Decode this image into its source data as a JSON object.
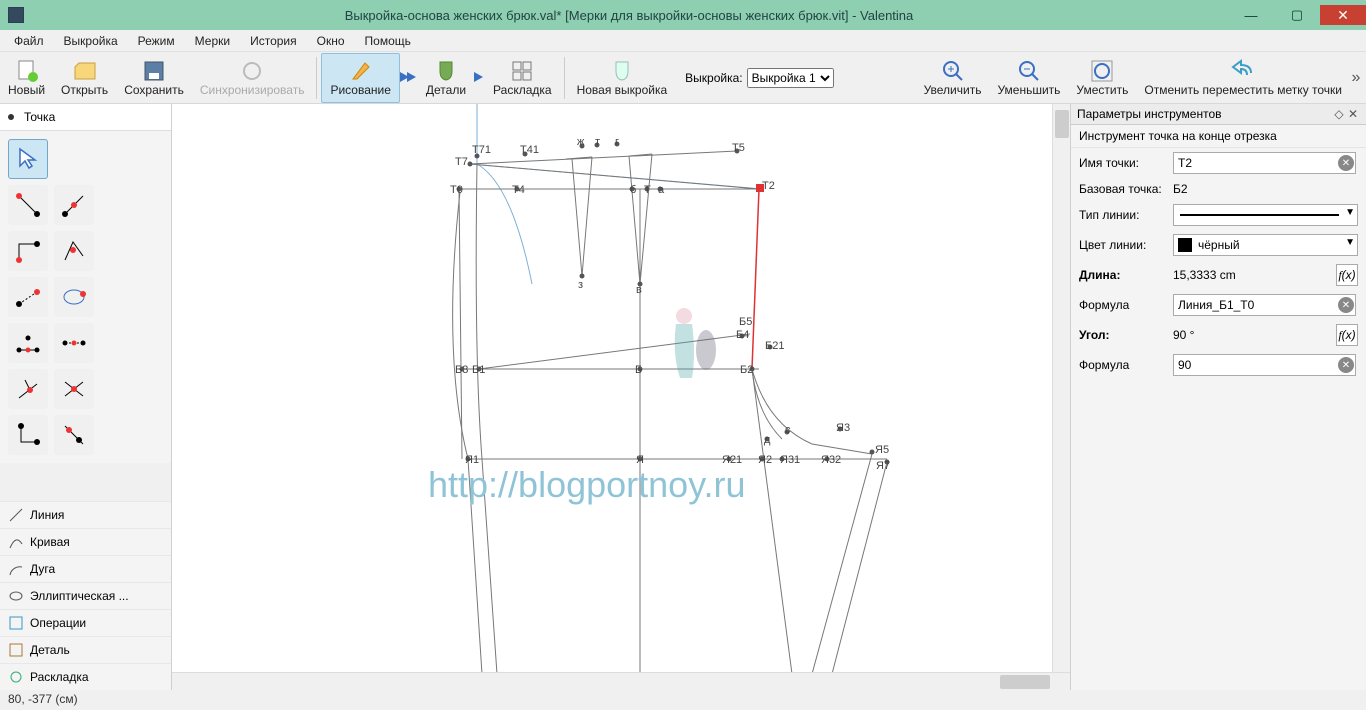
{
  "window": {
    "title": "Выкройка-основа женских брюк.val* [Мерки для выкройки-основы женских брюк.vit] - Valentina"
  },
  "menu": {
    "file": "Файл",
    "pattern": "Выкройка",
    "mode": "Режим",
    "measure": "Мерки",
    "history": "История",
    "window": "Окно",
    "help": "Помощь"
  },
  "toolbar": {
    "new": "Новый",
    "open": "Открыть",
    "save": "Сохранить",
    "sync": "Синхронизировать",
    "draw": "Рисование",
    "details": "Детали",
    "layout": "Раскладка",
    "newpat": "Новая выкройка",
    "patlabel": "Выкройка:",
    "patsel": "Выкройка 1",
    "zoomin": "Увеличить",
    "zoomout": "Уменьшить",
    "fit": "Уместить",
    "undo": "Отменить переместить метку точки"
  },
  "leftcat": {
    "point": "Точка",
    "line": "Линия",
    "curve": "Кривая",
    "arc": "Дуга",
    "ell": "Эллиптическая ...",
    "ops": "Операции",
    "detail": "Деталь",
    "layout": "Раскладка"
  },
  "labels": {
    "T7": "Т7",
    "T71": "Т71",
    "T41": "Т41",
    "zh": "ж",
    "t": "т",
    "g": "г",
    "T5": "Т5",
    "T0": "Т0",
    "T4": "Т4",
    "b": "б",
    "T": "Т",
    "a": "а",
    "T2": "Т2",
    "z": "з",
    "v": "в",
    "B3": "Б3",
    "B1": "Б1",
    "B": "Б",
    "B4": "Б4",
    "B5": "Б5",
    "B21": "Б21",
    "B2": "Б2",
    "d": "д",
    "c": "с",
    "Ya3": "Я3",
    "Ya5": "Я5",
    "Ya7": "Я7",
    "Ya32": "Я32",
    "Ya31": "Я31",
    "Ya2": "Я2",
    "Ya21": "Я21",
    "Ya": "Я",
    "Ya1": "Я1"
  },
  "watermark": "http://blogportnoy.ru",
  "props": {
    "title": "Параметры инструментов",
    "sub": "Инструмент точка на конце отрезка",
    "name_l": "Имя точки:",
    "name_v": "Т2",
    "base_l": "Базовая точка:",
    "base_v": "Б2",
    "ltype_l": "Тип линии:",
    "lcolor_l": "Цвет линии:",
    "lcolor_v": "чёрный",
    "len_l": "Длина:",
    "len_v": "15,3333 cm",
    "f1_l": "Формула",
    "f1_v": "Линия_Б1_Т0",
    "ang_l": "Угол:",
    "ang_v": "90 °",
    "f2_l": "Формула",
    "f2_v": "90"
  },
  "status": "80, -377 (см)"
}
